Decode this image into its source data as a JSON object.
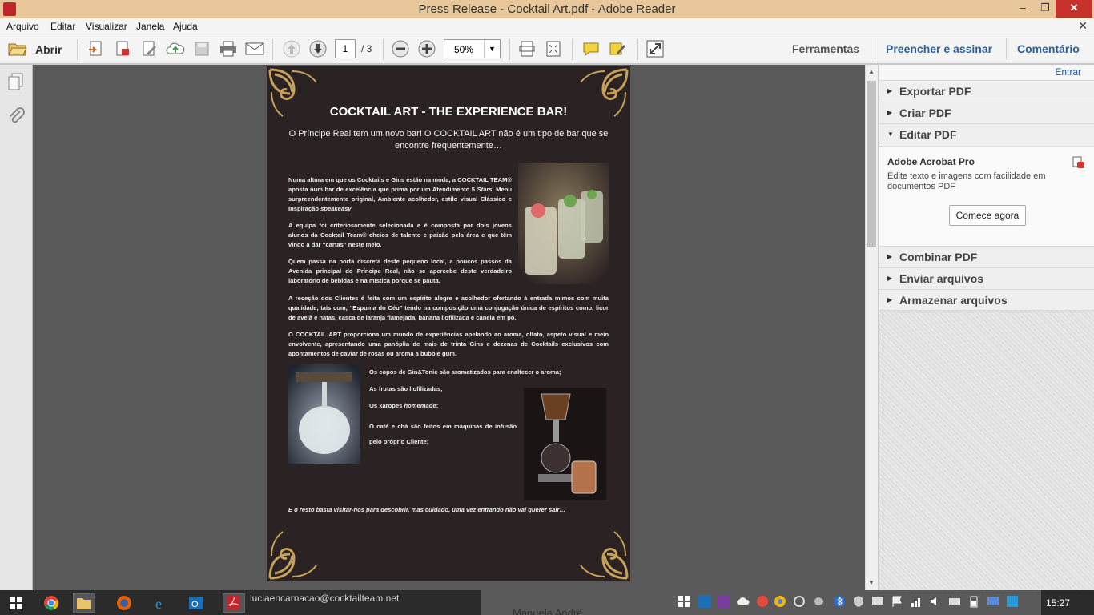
{
  "window": {
    "title": "Press Release - Cocktail Art.pdf - Adobe Reader",
    "minimize_glyph": "–",
    "maximize_glyph": "❐",
    "close_glyph": "✕"
  },
  "menu": {
    "items": [
      "Arquivo",
      "Editar",
      "Visualizar",
      "Janela",
      "Ajuda"
    ],
    "close_glyph": "✕"
  },
  "toolbar": {
    "open_label": "Abrir",
    "page_current": "1",
    "page_total": "/ 3",
    "zoom": "50%",
    "zoom_arrow": "▼",
    "right_links": [
      "Ferramentas",
      "Preencher e assinar",
      "Comentário"
    ],
    "colors": {
      "ferramentas": "#555555",
      "links": "#2e5f96"
    }
  },
  "document": {
    "title": "COCKTAIL ART - THE EXPERIENCE BAR!",
    "subtitle": "O Príncipe Real tem um novo bar! O COCKTAIL ART não é um tipo de bar que se encontre frequentemente…",
    "p1_a": "Numa altura em que os Cocktails e Gins estão na moda, a COCKTAIL TEAM® aposta num bar de excelência que prima por um Atendimento 5 ",
    "p1_b": "Stars",
    "p1_c": ", Menu surpreendentemente original, Ambiente acolhedor, estilo visual Clássico e Inspiração ",
    "p1_d": "speakeasy",
    "p1_e": ".",
    "p2": "A equipa foi criteriosamente selecionada e é composta por dois jovens alunos da Cocktail Team® cheios de talento e paixão pela área e que têm vindo a dar “cartas” neste meio.",
    "p3": "Quem passa na porta discreta deste pequeno local, a poucos passos da Avenida principal do Príncipe Real, não se apercebe deste verdadeiro laboratório de bebidas e na mística porque se pauta.",
    "p4": "A receção dos Clientes é feita com um espírito alegre e acolhedor ofertando à entrada mimos com muita qualidade, tais com, “Espuma do Céu” tendo na composição uma conjugação única de espíritos como, licor de avelã e natas, casca de laranja flamejada, banana liofilizada e canela em pó.",
    "p5": "O COCKTAIL ART proporciona um mundo de experiências apelando ao aroma, olfato, aspeto visual e meio envolvente, apresentando uma panóplia de mais de trinta Gins e dezenas de Cocktails exclusivos com apontamentos de caviar de rosas ou aroma a bubble gum.",
    "bullet1": "Os copos de Gin&Tonic são aromatizados para enaltecer o aroma;",
    "bullet2": "As frutas são liofilizadas;",
    "bullet3_a": "Os xaropes ",
    "bullet3_b": "homemade",
    "bullet3_c": ";",
    "bullet4": "O café e chá são feitos em máquinas de infusão pelo próprio Cliente;",
    "footer": "E o resto basta visitar-nos para descobrir, mas cuidado, uma vez entrando não vai querer sair…"
  },
  "right_pane": {
    "signin": "Entrar",
    "sections_top": [
      "Exportar PDF",
      "Criar PDF",
      "Editar PDF"
    ],
    "acrobat_title": "Adobe Acrobat Pro",
    "acrobat_desc": "Edite texto e imagens com facilidade em documentos PDF",
    "start_button": "Comece agora",
    "sections_bottom": [
      "Combinar PDF",
      "Enviar arquivos",
      "Armazenar arquivos"
    ],
    "collapsed_glyph": "▶",
    "expanded_glyph": "▼"
  },
  "taskbar": {
    "ghost_email": "luciaencаrnacao@cocktailteam.net",
    "ghost_name": "Manuela André",
    "time": "15:27"
  }
}
